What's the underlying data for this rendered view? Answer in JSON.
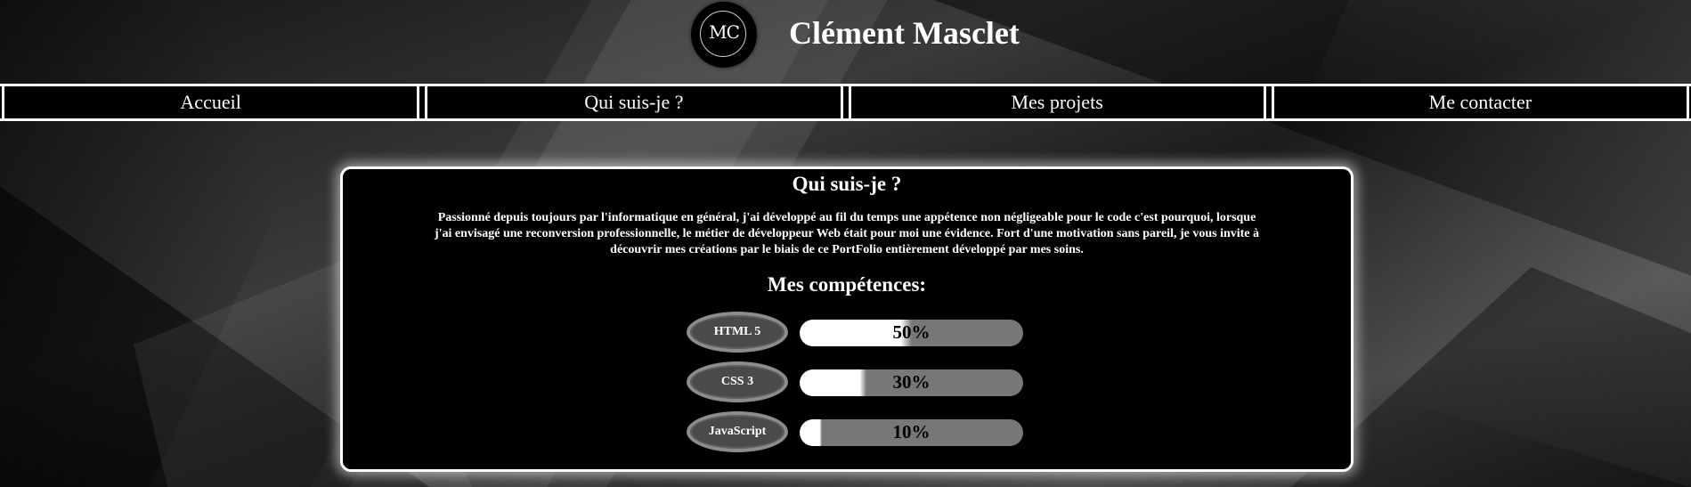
{
  "header": {
    "logo_text": "MC",
    "title": "Clément Masclet"
  },
  "nav": {
    "items": [
      {
        "label": "Accueil"
      },
      {
        "label": "Qui suis-je ?"
      },
      {
        "label": "Mes projets"
      },
      {
        "label": "Me contacter"
      }
    ]
  },
  "about": {
    "title": "Qui suis-je ?",
    "text": "Passionné depuis toujours par l'informatique en général, j'ai développé au fil du temps une appétence non négligeable pour le code c'est pourquoi, lorsque j'ai envisagé une reconversion professionnelle, le métier de développeur Web était pour moi une évidence. Fort d'une motivation sans pareil, je vous invite à découvrir mes créations par le biais de ce PortFolio entièrement développé par mes soins.",
    "skills_title": "Mes compétences:",
    "skills": [
      {
        "name": "HTML 5",
        "percent_label": "50%",
        "level": 0.5
      },
      {
        "name": "CSS 3",
        "percent_label": "30%",
        "level": 0.3
      },
      {
        "name": "JavaScript",
        "percent_label": "10%",
        "level": 0.1
      }
    ]
  },
  "colors": {
    "card_background": "#000000",
    "card_border": "#ffffff",
    "bar_track": "#777777",
    "bar_fill": "#ffffff"
  }
}
